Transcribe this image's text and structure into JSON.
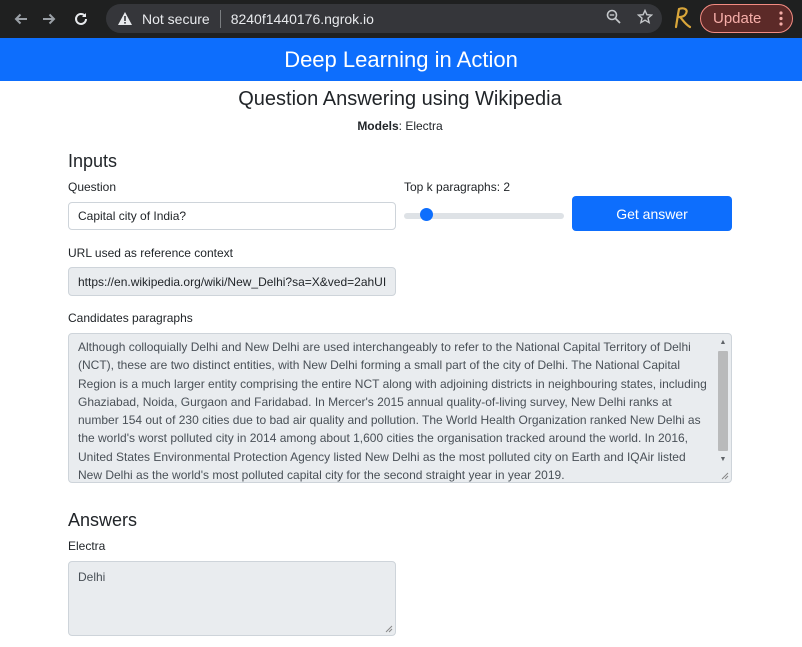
{
  "browser": {
    "security_label": "Not secure",
    "url": "8240f1440176.ngrok.io",
    "update_label": "Update",
    "icons": [
      "back-arrow-icon",
      "forward-arrow-icon",
      "reload-icon",
      "warning-icon",
      "zoom-icon",
      "star-icon",
      "extension-icon",
      "menu-dots-icon"
    ]
  },
  "banner": {
    "title": "Deep Learning in Action"
  },
  "header": {
    "title": "Question Answering using Wikipedia",
    "models_label": "Models",
    "models_value": ": Electra"
  },
  "inputs": {
    "heading": "Inputs",
    "question_label": "Question",
    "question_value": "Capital city of India?",
    "topk_label": "Top k paragraphs: 2",
    "topk_value": 2,
    "topk_min": 1,
    "topk_max": 10,
    "submit_label": "Get answer",
    "url_label": "URL used as reference context",
    "url_value": "https://en.wikipedia.org/wiki/New_Delhi?sa=X&ved=2ahUI",
    "candidates_label": "Candidates paragraphs",
    "candidates_text": "Although colloquially Delhi and New Delhi are used interchangeably to refer to the National Capital Territory of Delhi (NCT), these are two distinct entities, with New Delhi forming a small part of the city of Delhi. The National Capital Region is a much larger entity comprising the entire NCT along with adjoining districts in neighbouring states, including Ghaziabad, Noida, Gurgaon and Faridabad. In Mercer's 2015 annual quality-of-living survey, New Delhi ranks at number 154 out of 230 cities due to bad air quality and pollution. The World Health Organization ranked New Delhi as the world's worst polluted city in 2014 among about 1,600 cities the organisation tracked around the world. In 2016, United States Environmental Protection Agency listed New Delhi as the most polluted city on Earth and IQAir listed New Delhi as the world's most polluted capital city for the second straight year in year 2019."
  },
  "answers": {
    "heading": "Answers",
    "model_label": "Electra",
    "answer_value": "Delhi"
  },
  "colors": {
    "primary": "#0d6efd",
    "chrome_bg": "#1f2020",
    "readonly_bg": "#e9ecef"
  }
}
